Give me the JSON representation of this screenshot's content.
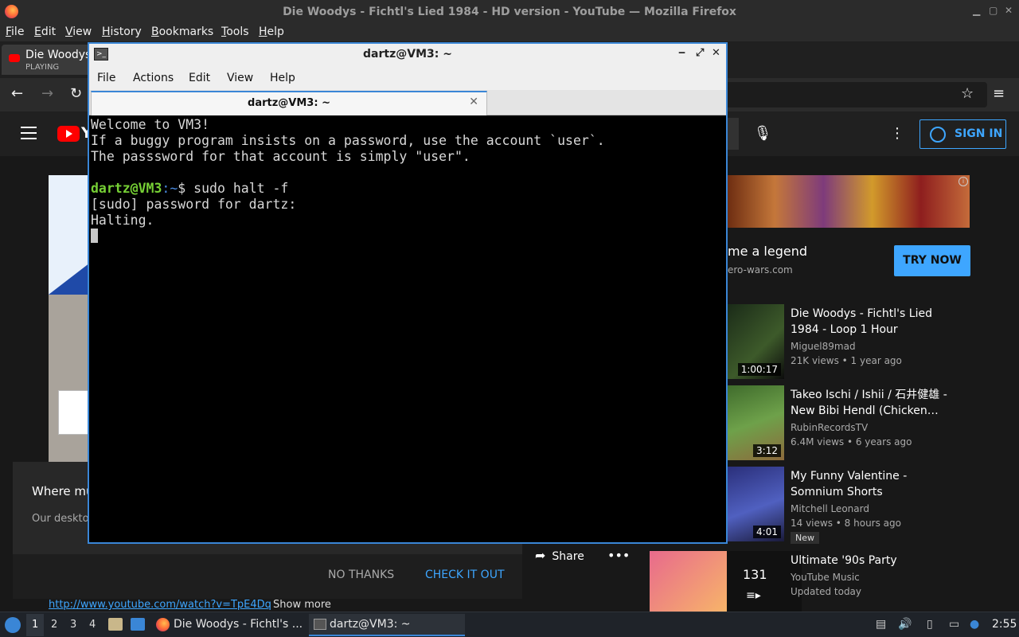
{
  "firefox": {
    "window_title": "Die Woodys - Fichtl's Lied 1984 - HD version - YouTube — Mozilla Firefox",
    "menu": [
      "File",
      "Edit",
      "View",
      "History",
      "Bookmarks",
      "Tools",
      "Help"
    ],
    "tab": {
      "title": "Die Woodys",
      "status": "PLAYING"
    }
  },
  "youtube": {
    "sign_in": "SIGN IN",
    "popup": {
      "heading": "Where mu",
      "subtext": "Our desktop",
      "no_thanks": "NO THANKS",
      "check_it_out": "CHECK IT OUT"
    },
    "url_link": "http://www.youtube.com/watch?v=TpE4Dq",
    "show_more": "Show more",
    "share": "Share",
    "ad": {
      "title": "me a legend",
      "domain": "ero-wars.com",
      "cta": "TRY NOW"
    },
    "related": [
      {
        "title": "Die Woodys - Fichtl's Lied 1984 - Loop 1 Hour",
        "channel": "Miguel89mad",
        "meta": "21K views • 1 year ago",
        "duration": "1:00:17"
      },
      {
        "title": "Takeo Ischi / Ishii / 石井健雄 - New Bibi Hendl (Chicken…",
        "channel": "RubinRecordsTV",
        "meta": "6.4M views • 6 years ago",
        "duration": "3:12"
      },
      {
        "title": "My Funny Valentine - Somnium Shorts",
        "channel": "Mitchell Leonard",
        "meta": "14 views • 8 hours ago",
        "duration": "4:01",
        "badge": "New"
      },
      {
        "title": "Ultimate '90s Party",
        "channel": "YouTube Music",
        "meta": "Updated today",
        "count": "131"
      }
    ]
  },
  "terminal": {
    "window_title": "dartz@VM3: ~",
    "menu": [
      "File",
      "Actions",
      "Edit",
      "View",
      "Help"
    ],
    "tab_label": "dartz@VM3: ~",
    "lines": [
      "Welcome to VM3!",
      "If a buggy program insists on a password, use the account `user`.",
      "The passsword for that account is simply \"user\"."
    ],
    "prompt_user": "dartz@VM3",
    "prompt_path": ":~",
    "prompt_symbol": "$ ",
    "command": "sudo halt -f",
    "output": [
      "[sudo] password for dartz:",
      "Halting."
    ]
  },
  "taskbar": {
    "workspaces": [
      "1",
      "2",
      "3",
      "4"
    ],
    "tasks": [
      "Die Woodys - Fichtl's ...",
      "dartz@VM3: ~"
    ],
    "clock": "2:55"
  },
  "colors": {
    "accent": "#3a86d6",
    "yt_blue": "#3ea6ff",
    "prompt_green": "#76d035"
  }
}
